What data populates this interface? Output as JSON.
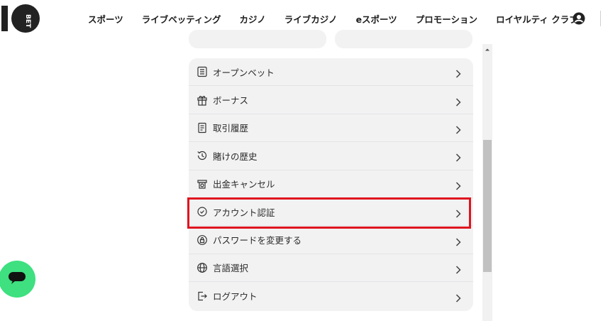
{
  "brand": {
    "logo_text_top": "10",
    "logo_text_side": "BET",
    "accent": "#3ee07f",
    "highlight": "#e0141e"
  },
  "nav": {
    "items": [
      "スポーツ",
      "ライブベッティング",
      "カジノ",
      "ライブカジノ",
      "eスポーツ",
      "プロモーション",
      "ロイヤルティ クラブ"
    ]
  },
  "menu": {
    "items": [
      {
        "label": "オープンベット",
        "icon": "list-icon"
      },
      {
        "label": "ボーナス",
        "icon": "gift-icon"
      },
      {
        "label": "取引履歴",
        "icon": "document-icon"
      },
      {
        "label": "賭けの歴史",
        "icon": "history-clock-icon"
      },
      {
        "label": "出金キャンセル",
        "icon": "withdraw-cancel-icon"
      },
      {
        "label": "アカウント認証",
        "icon": "verify-badge-icon"
      },
      {
        "label": "パスワードを変更する",
        "icon": "lock-icon"
      },
      {
        "label": "言語選択",
        "icon": "globe-icon"
      },
      {
        "label": "ログアウト",
        "icon": "logout-icon"
      }
    ],
    "highlighted_index": 5
  }
}
